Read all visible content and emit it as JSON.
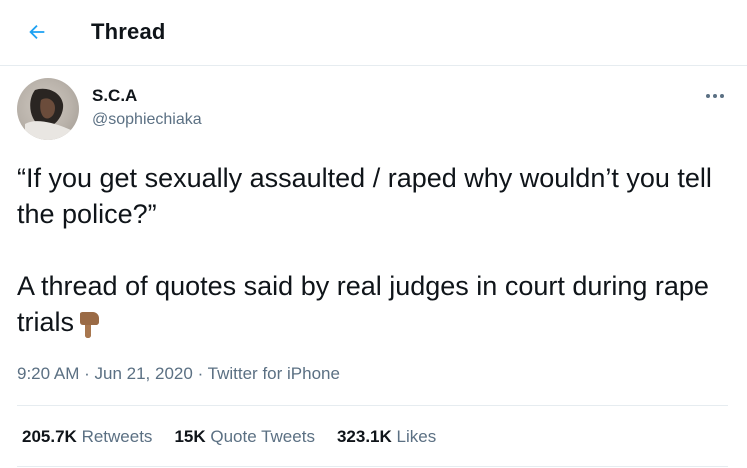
{
  "header": {
    "title": "Thread",
    "back_icon": "arrow-left-icon",
    "accent_color": "#1da1f2"
  },
  "tweet": {
    "author": {
      "display_name": "S.C.A",
      "handle": "@sophiechiaka"
    },
    "more_icon": "more-horizontal-icon",
    "text_line1": "“If you get sexually assaulted / raped why wouldn’t you tell the police?”",
    "text_line2": "A thread of quotes said by real judges in court during rape trials",
    "emoji": "pointing-down-icon",
    "time": "9:20 AM",
    "separator": "·",
    "date": "Jun 21, 2020",
    "source": "Twitter for iPhone"
  },
  "stats": {
    "retweets_count": "205.7K",
    "retweets_label": "Retweets",
    "quotes_count": "15K",
    "quotes_label": "Quote Tweets",
    "likes_count": "323.1K",
    "likes_label": "Likes"
  }
}
